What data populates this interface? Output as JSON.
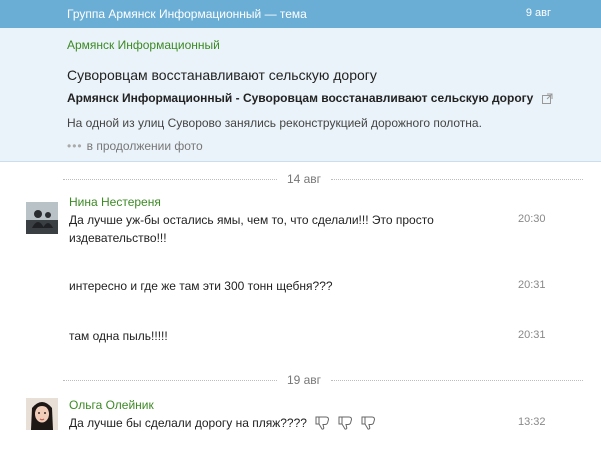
{
  "header": {
    "title": "Группа Армянск Информационный — тема",
    "date": "9 авг"
  },
  "post": {
    "author": "Армянск Информационный",
    "heading": "Суворовцам восстанавливают сельскую дорогу",
    "link_title": "Армянск Информационный - Суворовцам восстанавливают сельскую дорогу",
    "description": "На одной из улиц Суворово занялись реконструкцией дорожного полотна.",
    "more_dots": "•••",
    "more_label": "в продолжении фото",
    "icons": [
      "external-link-icon",
      "ellipsis-icon"
    ]
  },
  "comment_groups": [
    {
      "date": "14 авг",
      "author": "Нина Нестереня",
      "messages": [
        {
          "text": "Да лучше уж-бы остались ямы, чем то, что сделали!!! Это просто издевательство!!!",
          "time": "20:30"
        },
        {
          "text": "интересно и где же там эти 300 тонн щебня???",
          "time": "20:31"
        },
        {
          "text": "там одна пыль!!!!!",
          "time": "20:31"
        }
      ]
    },
    {
      "date": "19 авг",
      "author": "Ольга Олейник",
      "messages": [
        {
          "text": "Да лучше бы сделали дорогу на пляж????",
          "time": "13:32",
          "icons": [
            "thumbs-down-icon",
            "thumbs-down-icon",
            "thumbs-down-icon"
          ]
        }
      ]
    }
  ],
  "colors": {
    "header_bg": "#6aaed6",
    "post_bg": "#eaf3f9",
    "author_green": "#3c8a24"
  }
}
